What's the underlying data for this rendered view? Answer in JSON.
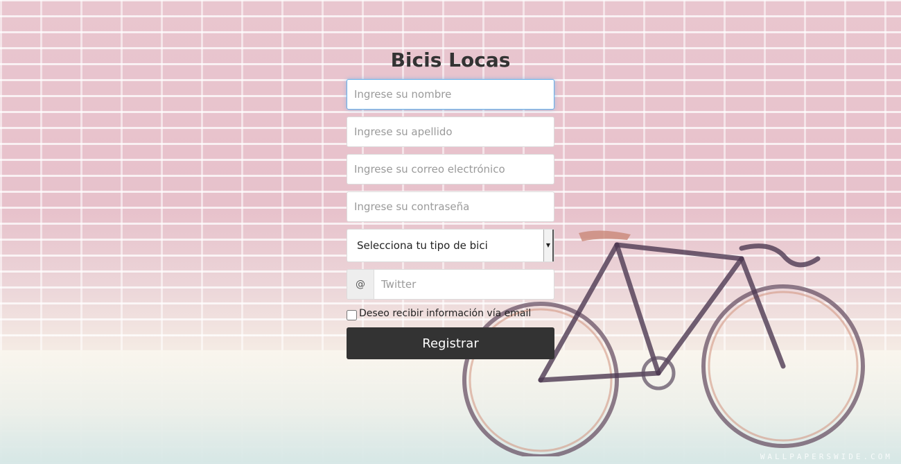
{
  "page": {
    "title": "Bicis Locas",
    "watermark": "WALLPAPERSWIDE.COM"
  },
  "form": {
    "nombre_placeholder": "Ingrese su nombre",
    "apellido_placeholder": "Ingrese su apellido",
    "correo_placeholder": "Ingrese su correo electrónico",
    "contrasena_placeholder": "Ingrese su contraseña",
    "bike_select_label": "Selecciona tu tipo de bici",
    "twitter_addon": "@",
    "twitter_placeholder": "Twitter",
    "newsletter_label": "Deseo recibir información vía email",
    "submit_label": "Registrar"
  },
  "colors": {
    "button_bg": "#333333",
    "focus_border": "#66afe9",
    "title_color": "#333333"
  },
  "icons": {
    "select_arrow": "caret-down-icon"
  }
}
